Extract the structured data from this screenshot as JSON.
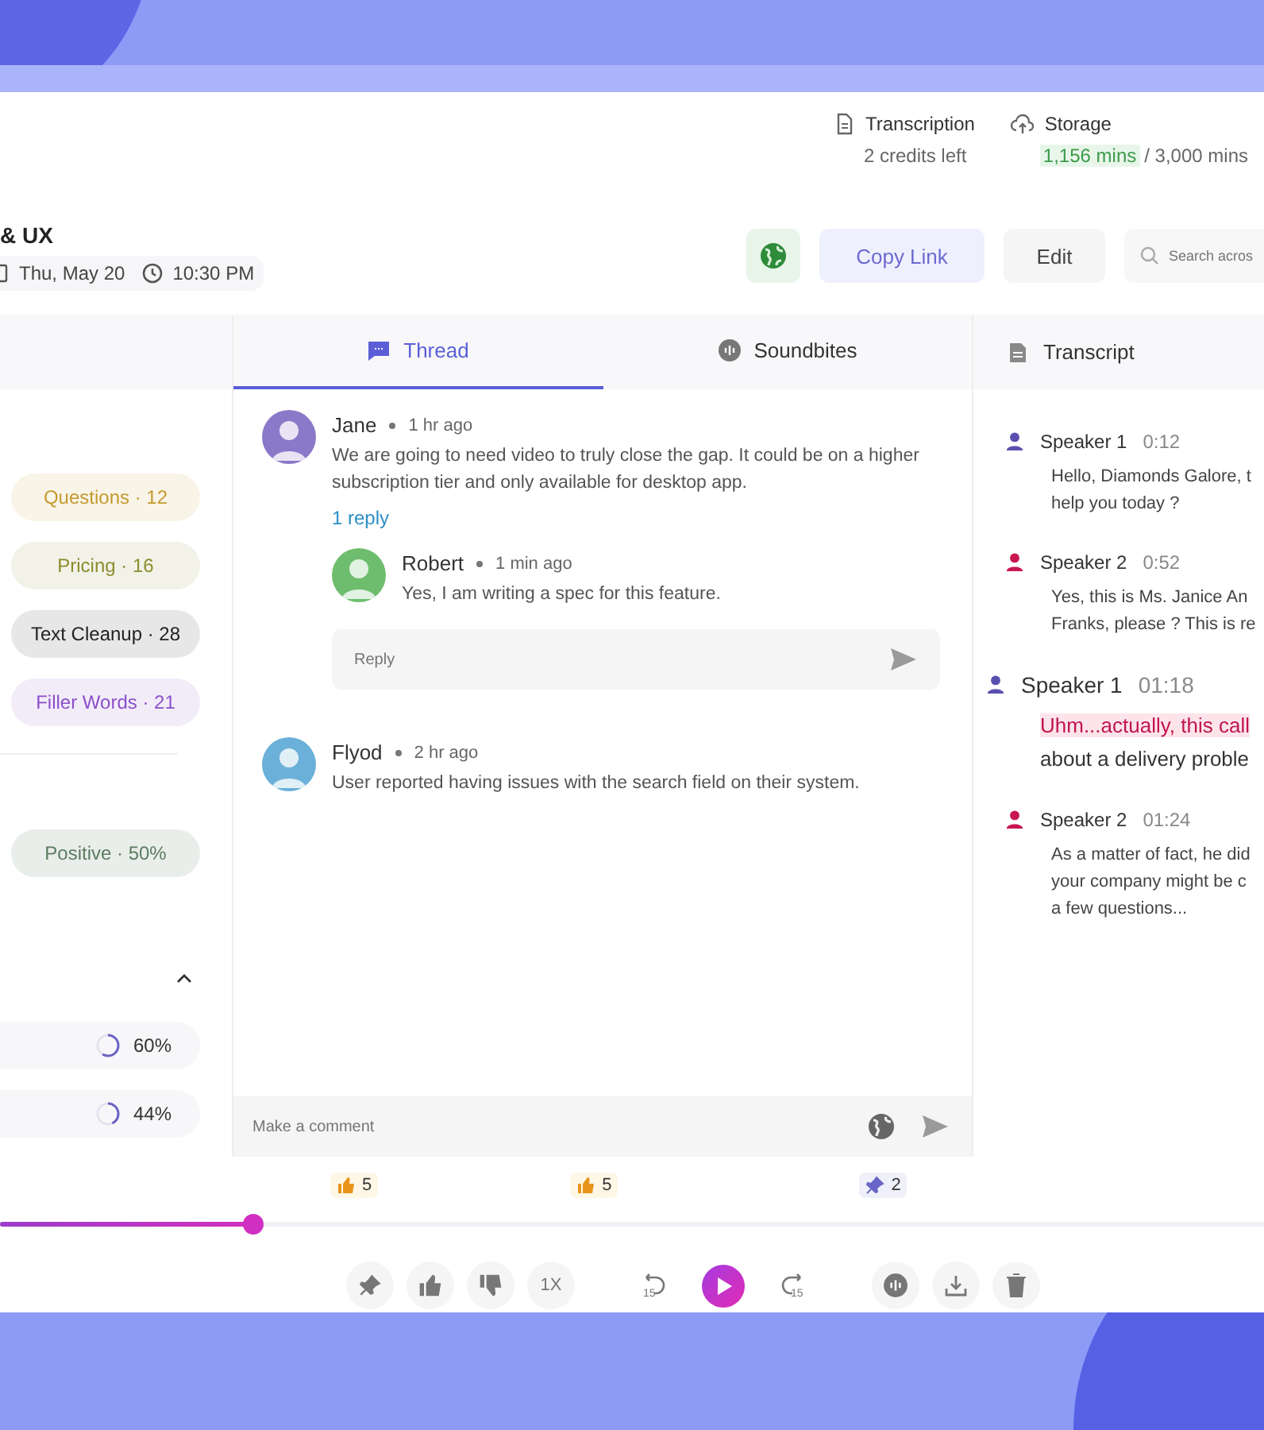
{
  "credits": [
    {
      "kind": "transcription",
      "label": "Transcription",
      "detail": "2 credits left"
    },
    {
      "kind": "storage",
      "label": "Storage",
      "used": "1,156 mins",
      "total": "/ 3,000 mins"
    }
  ],
  "meeting": {
    "title": "& UX",
    "date": "Thu, May 20",
    "time": "10:30 PM"
  },
  "actions": {
    "copy_link": "Copy Link",
    "edit": "Edit",
    "search": {
      "placeholder": "Search acros"
    }
  },
  "sidebar": {
    "tags": [
      {
        "label": "Questions · 12",
        "color": "#c49a2c"
      },
      {
        "label": "Pricing · 16",
        "color": "#8c8c2e"
      },
      {
        "label": "Text Cleanup · 28",
        "color": "#222222"
      },
      {
        "label": "Filler Words · 21",
        "color": "#8b4fc9"
      }
    ],
    "sentiment": {
      "label": "Positive · 50%",
      "color": "#5b7c61"
    },
    "topics": [
      {
        "reading": "60%",
        "level": 0.6
      },
      {
        "reading": "44%",
        "level": 0.44
      }
    ]
  },
  "tabs": [
    {
      "kind": "thread",
      "label": "Thread",
      "selected": true
    },
    {
      "kind": "soundbites",
      "label": "Soundbites",
      "selected": false
    }
  ],
  "comments": [
    {
      "author": "Jane",
      "time": "1 hr ago",
      "color": "#8a78c8",
      "text": "We are going to need video to truly close the gap. It could be on a higher subscription tier and only available for desktop app.",
      "reply_count": "1 reply",
      "replies": [
        {
          "author": "Robert",
          "time": "1 min ago",
          "color": "#6ebd6e",
          "text": "Yes, I am writing a spec for this feature."
        }
      ],
      "reply_field": {
        "placeholder": "Reply"
      }
    },
    {
      "author": "Flyod",
      "time": "2 hr ago",
      "color": "#6ab0d8",
      "text": "User reported having issues with the search field on their system."
    }
  ],
  "comment_field": {
    "placeholder": "Make a comment"
  },
  "transcript": {
    "title": "Transcript",
    "entries": [
      {
        "speaker": "Speaker 1",
        "time": "0:12",
        "color": "#5a4fb0",
        "selected": false,
        "lines": [
          {
            "text": "Hello, Diamonds Galore, t",
            "highlighted": false
          },
          {
            "text": "help you today ?",
            "highlighted": false
          }
        ]
      },
      {
        "speaker": "Speaker 2",
        "time": "0:52",
        "color": "#c8164f",
        "selected": false,
        "lines": [
          {
            "text": "Yes, this is Ms. Janice An",
            "highlighted": false
          },
          {
            "text": "Franks, please ? This is re",
            "highlighted": false
          }
        ]
      },
      {
        "speaker": "Speaker 1",
        "time": "01:18",
        "color": "#5a4fb0",
        "selected": true,
        "lines": [
          {
            "text": "Uhm...actually, this call",
            "highlighted": true
          },
          {
            "text": "about a delivery proble",
            "highlighted": false
          }
        ]
      },
      {
        "speaker": "Speaker 2",
        "time": "01:24",
        "color": "#c8164f",
        "selected": false,
        "lines": [
          {
            "text": "As a matter of fact, he did",
            "highlighted": false
          },
          {
            "text": "your company might be c",
            "highlighted": false
          },
          {
            "text": "a few questions...",
            "highlighted": false
          }
        ]
      }
    ]
  },
  "reactions": [
    {
      "kind": "like",
      "count": "5"
    },
    {
      "kind": "like",
      "count": "5"
    },
    {
      "kind": "pin",
      "count": "2"
    }
  ],
  "timeline": {
    "level": 0.2
  },
  "controls": [
    {
      "kind": "pin"
    },
    {
      "kind": "like"
    },
    {
      "kind": "dislike"
    },
    {
      "kind": "speed",
      "label": "1X"
    },
    {
      "kind": "rewind",
      "label": "15"
    },
    {
      "kind": "play"
    },
    {
      "kind": "forward",
      "label": "15"
    },
    {
      "kind": "soundbite"
    },
    {
      "kind": "download"
    },
    {
      "kind": "delete"
    }
  ]
}
